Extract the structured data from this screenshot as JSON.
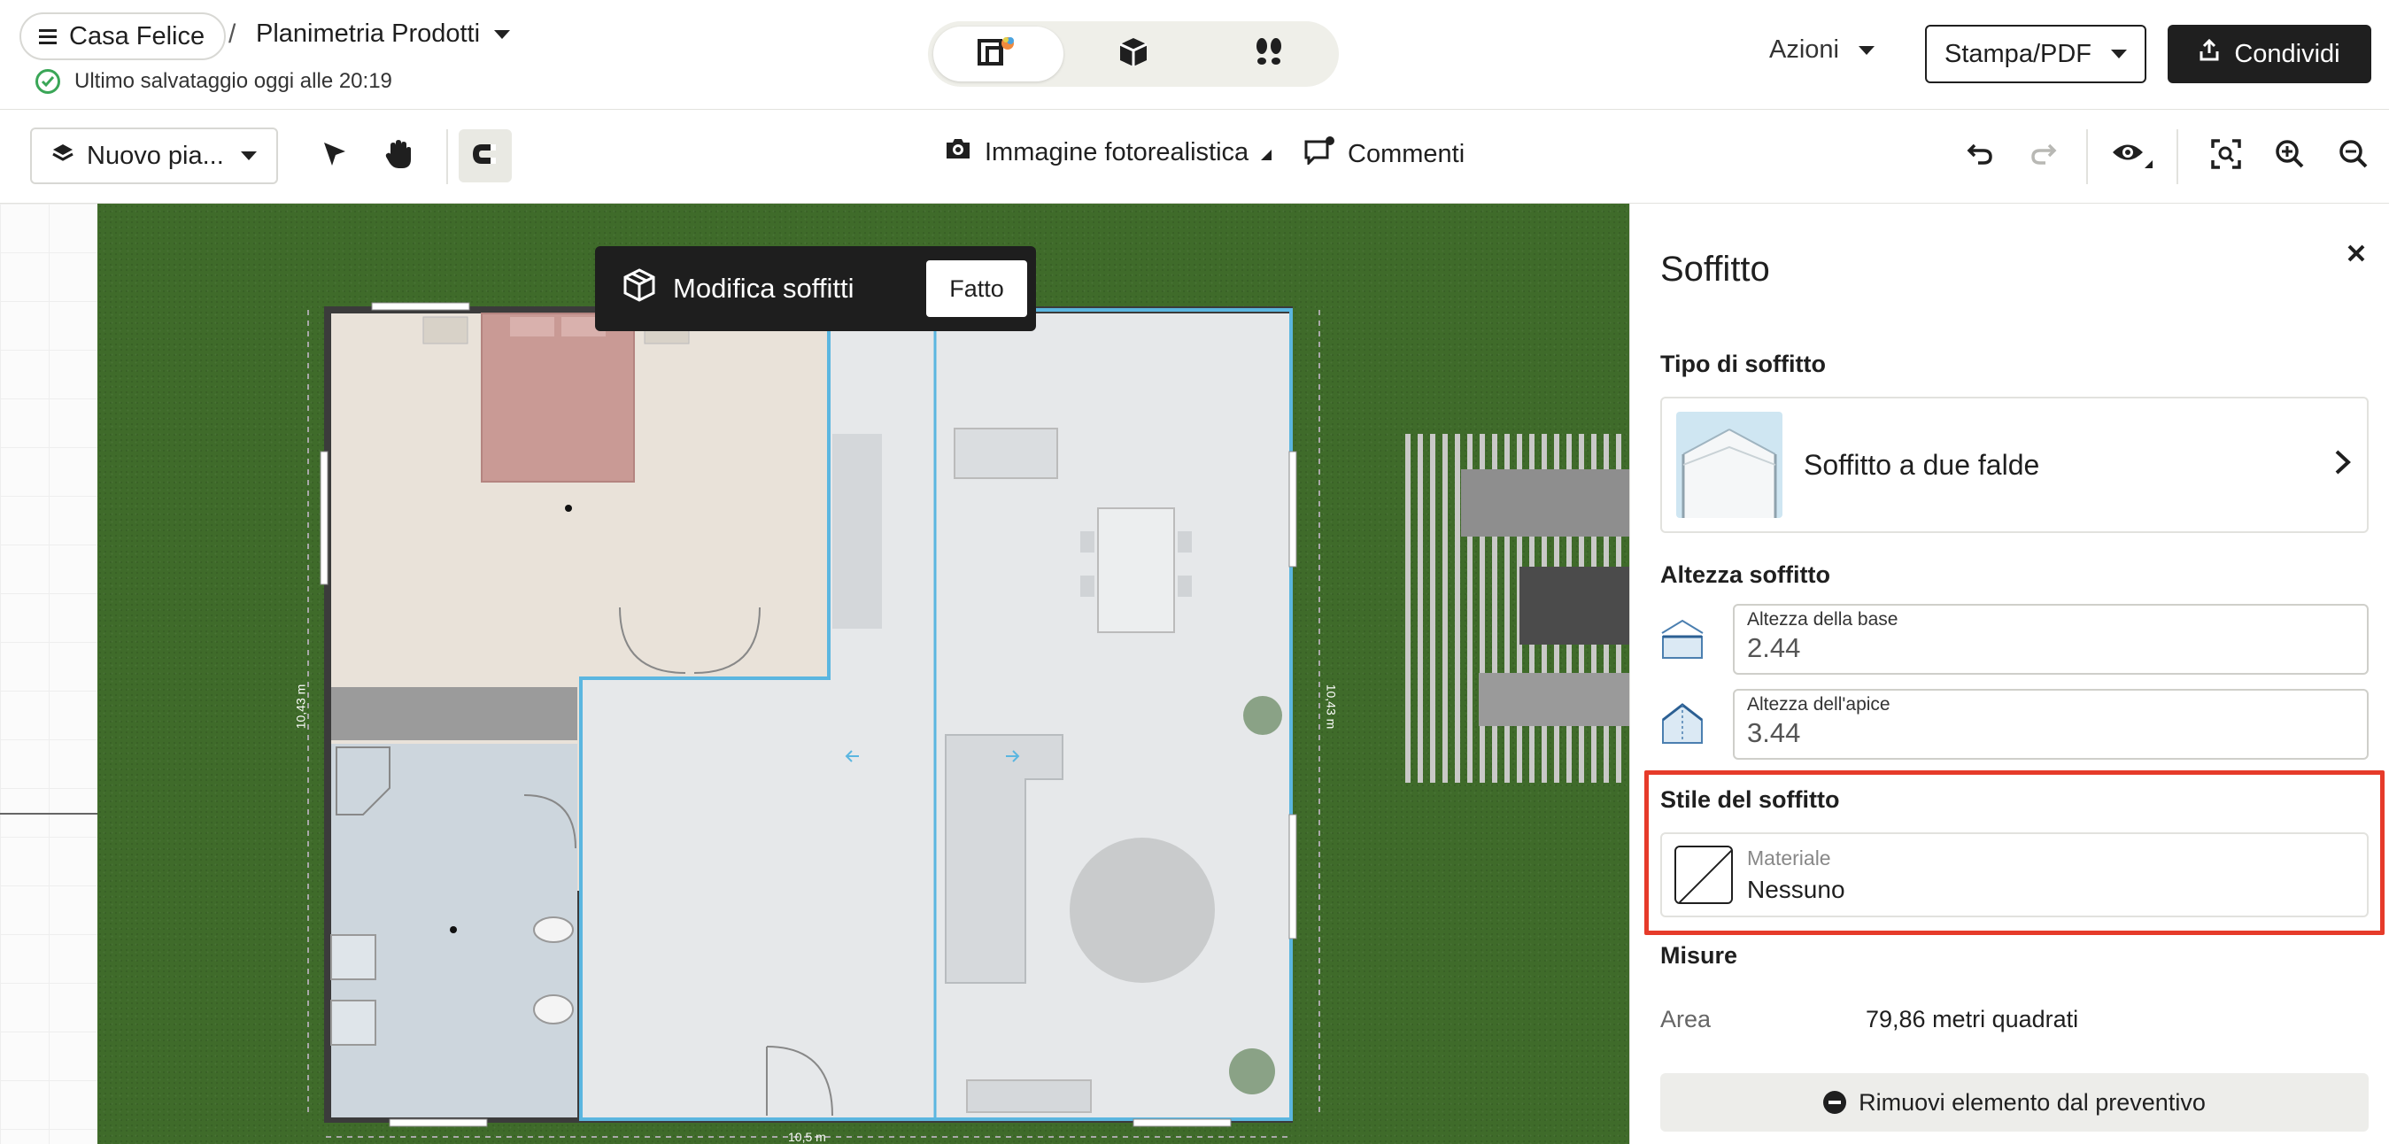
{
  "header": {
    "project_name": "Casa Felice",
    "separator": "/",
    "plan_name": "Planimetria Prodotti",
    "save_status": "Ultimo salvataggio oggi alle 20:19",
    "view_modes": [
      "2d-color-plan-icon",
      "3d-box-icon",
      "walkthrough-footprints-icon"
    ],
    "actions_label": "Azioni",
    "print_label": "Stampa/PDF",
    "share_label": "Condividi"
  },
  "toolbar": {
    "floor_select": "Nuovo pia...",
    "photo_label": "Immagine fotorealistica",
    "comments_label": "Commenti"
  },
  "canvas": {
    "banner_title": "Modifica soffitti",
    "banner_done": "Fatto",
    "dimension_left": "10,43 m",
    "dimension_right": "10,43 m",
    "dimension_bottom": "10,5 m"
  },
  "panel": {
    "title": "Soffitto",
    "ceiling_type_label": "Tipo di soffitto",
    "ceiling_type_value": "Soffitto a due falde",
    "height_label": "Altezza soffitto",
    "base_height_label": "Altezza della base",
    "base_height_value": "2.44",
    "apex_height_label": "Altezza dell'apice",
    "apex_height_value": "3.44",
    "style_label": "Stile del soffitto",
    "material_label": "Materiale",
    "material_value": "Nessuno",
    "measures_label": "Misure",
    "area_key": "Area",
    "area_value": "79,86 metri quadrati",
    "remove_label": "Rimuovi elemento dal preventivo"
  },
  "colors": {
    "highlight": "#e63b2a",
    "grass": "#3f6b2a",
    "selection_blue": "#5bb6e0",
    "dark_button": "#1f1f1f"
  }
}
